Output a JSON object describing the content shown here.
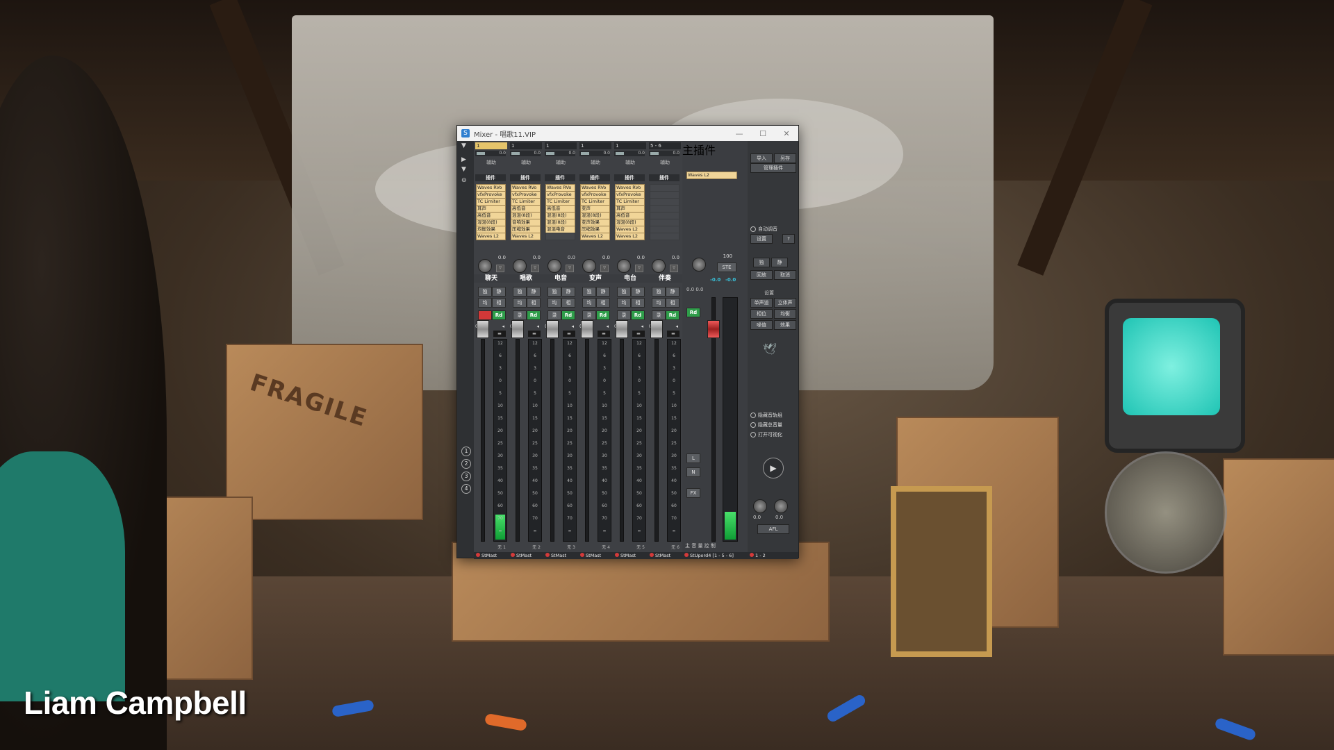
{
  "window": {
    "title": "Mixer - 唱歌11.VIP"
  },
  "caption": "Liam Campbell",
  "channels": [
    {
      "sel": "1",
      "fx": "0.0",
      "send": "辅助",
      "insert": "插件",
      "plugins": [
        "Waves RVo",
        "vfxProvoke",
        "TC Limiter",
        "耳声",
        "高低音",
        "混混(8段)",
        "均衡效果",
        "Waves L2"
      ],
      "pan": "0.0",
      "name": "聊天",
      "b1": "独",
      "b2": "静",
      "b3": "均",
      "b4": "相",
      "recLabel": "",
      "rd": "Rd",
      "fader": "0.0",
      "num": "1",
      "group": "无",
      "output": "StMast",
      "recActive": true
    },
    {
      "sel": "1",
      "fx": "0.0",
      "send": "辅助",
      "insert": "插件",
      "plugins": [
        "Waves RVo",
        "vfxProvoke",
        "TC Limiter",
        "高低音",
        "混混(8段)",
        "音响效果",
        "压缩效果",
        "Waves L2"
      ],
      "pan": "0.0",
      "name": "唱歌",
      "b1": "独",
      "b2": "静",
      "b3": "均",
      "b4": "相",
      "recLabel": "录",
      "rd": "Rd",
      "fader": "0.0",
      "num": "2",
      "group": "无",
      "output": "StMast",
      "recActive": false
    },
    {
      "sel": "1",
      "fx": "0.0",
      "send": "辅助",
      "insert": "插件",
      "plugins": [
        "Waves RVo",
        "vfxProvoke",
        "TC Limiter",
        "高低音",
        "混混(8段)",
        "混混(8段)",
        "混混电音",
        ""
      ],
      "pan": "0.0",
      "name": "电音",
      "b1": "独",
      "b2": "静",
      "b3": "均",
      "b4": "相",
      "recLabel": "录",
      "rd": "Rd",
      "fader": "0.0",
      "num": "3",
      "group": "无",
      "output": "StMast",
      "recActive": false
    },
    {
      "sel": "1",
      "fx": "0.0",
      "send": "辅助",
      "insert": "插件",
      "plugins": [
        "Waves RVo",
        "vfxProvoke",
        "TC Limiter",
        "变声",
        "混混(8段)",
        "变声效果",
        "压缩效果",
        "Waves L2"
      ],
      "pan": "0.0",
      "name": "变声",
      "b1": "独",
      "b2": "静",
      "b3": "均",
      "b4": "相",
      "recLabel": "录",
      "rd": "Rd",
      "fader": "0.0",
      "num": "4",
      "group": "无",
      "output": "StMast",
      "recActive": false
    },
    {
      "sel": "1",
      "fx": "0.0",
      "send": "辅助",
      "insert": "插件",
      "plugins": [
        "Waves RVo",
        "vfxProvoke",
        "TC Limiter",
        "耳声",
        "高低音",
        "混混(8段)",
        "Waves L2",
        "Waves L2"
      ],
      "pan": "0.0",
      "name": "电台",
      "b1": "独",
      "b2": "静",
      "b3": "均",
      "b4": "相",
      "recLabel": "录",
      "rd": "Rd",
      "fader": "0.0",
      "num": "5",
      "group": "无",
      "output": "StMast",
      "recActive": false
    },
    {
      "sel": "5 - 6",
      "fx": "0.0",
      "send": "辅助",
      "insert": "插件",
      "plugins": [
        "",
        "",
        "",
        "",
        "",
        "",
        "",
        ""
      ],
      "pan": "0.0",
      "name": "伴奏",
      "b1": "独",
      "b2": "静",
      "b3": "均",
      "b4": "相",
      "recLabel": "录",
      "rd": "Rd",
      "fader": "0.0",
      "num": "6",
      "group": "无",
      "output": "StMast",
      "recActive": false
    }
  ],
  "master": {
    "insert": "主插件",
    "plugin": "Waves L2",
    "knob": "100",
    "ste": "STE",
    "peakL": "-0.0",
    "peakR": "-0.0",
    "levels": "0.0  0.0",
    "rd": "Rd",
    "btnL": "L",
    "btnN": "N",
    "btnFX": "FX",
    "output": "StUpord4 [1 - 5 - 6]",
    "label": "主 音 量 控 制"
  },
  "right": {
    "import": "导入",
    "save": "另存",
    "pluginMgr": "管理插件",
    "autoMix": "自动调音",
    "setup": "设置",
    "help": "?",
    "solo": "独",
    "mute": "静",
    "resetLbl": "音量",
    "r1": "回放",
    "r2": "取消",
    "mid": "设置",
    "m1": "单声道",
    "m2": "立体声",
    "m3": "相位",
    "m4": "均衡",
    "m5": "噪值",
    "m6": "效果",
    "opt1": "隐藏音轨组",
    "opt2": "隐藏总音量",
    "opt3": "打开可视化",
    "play": "▶",
    "k1": "0.0",
    "k2": "0.0",
    "afl": "AFL",
    "out": "1 - 2"
  },
  "meter_scale": [
    "12",
    "6",
    "3",
    "0",
    "5",
    "10",
    "15",
    "20",
    "25",
    "30",
    "35",
    "40",
    "50",
    "60",
    "70",
    "∞"
  ]
}
